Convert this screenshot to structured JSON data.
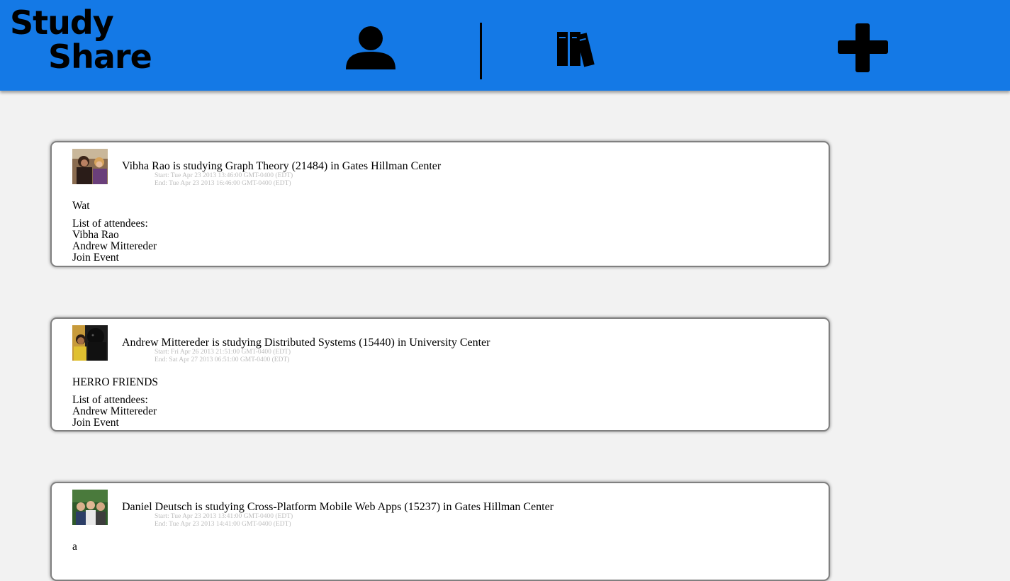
{
  "header": {
    "logo_line1": "Study",
    "logo_line2": "Share",
    "icons": {
      "profile": "user-icon",
      "library": "books-icon",
      "add": "plus-icon"
    },
    "bg_color": "#1479e6"
  },
  "events": [
    {
      "headline": "Vibha Rao is studying Graph Theory (21484) in Gates Hillman Center",
      "start": "Start: Tue Apr 23 2013 13:46:00 GMT-0400 (EDT)",
      "end": "End: Tue Apr 23 2013 16:46:00 GMT-0400 (EDT)",
      "description": "Wat",
      "attendees_label": "List of attendees:",
      "attendees": [
        "Vibha Rao",
        "Andrew Mittereder"
      ],
      "join_label": "Join Event"
    },
    {
      "headline": "Andrew Mittereder is studying Distributed Systems (15440) in University Center",
      "start": "Start: Fri Apr 26 2013 21:51:00 GMT-0400 (EDT)",
      "end": "End: Sat Apr 27 2013 06:51:00 GMT-0400 (EDT)",
      "description": "HERRO FRIENDS",
      "attendees_label": "List of attendees:",
      "attendees": [
        "Andrew Mittereder"
      ],
      "join_label": "Join Event"
    },
    {
      "headline": "Daniel Deutsch is studying Cross-Platform Mobile Web Apps (15237) in Gates Hillman Center",
      "start": "Start: Tue Apr 23 2013 13:41:00 GMT-0400 (EDT)",
      "end": "End: Tue Apr 23 2013 14:41:00 GMT-0400 (EDT)",
      "description": "a",
      "attendees_label": "",
      "attendees": [],
      "join_label": ""
    }
  ]
}
